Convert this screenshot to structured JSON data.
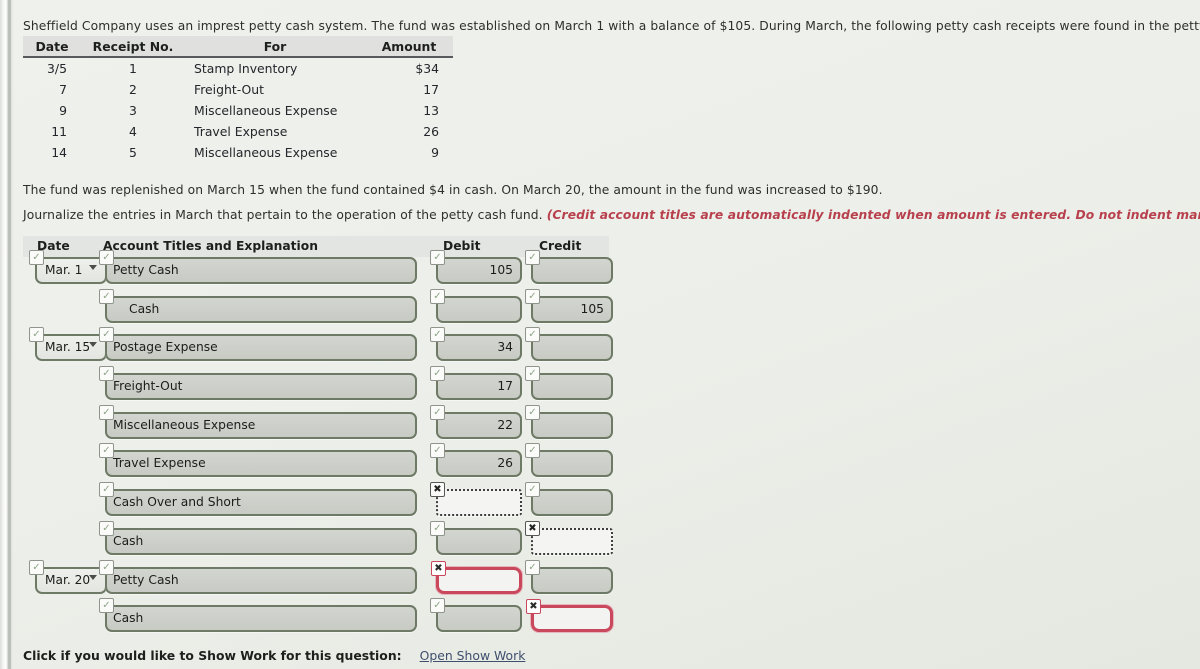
{
  "intro": {
    "text": "Sheffield Company uses an imprest petty cash system. The fund was established on March 1 with a balance of $105. During March, the following petty cash receipts were found in the petty cash box."
  },
  "receipts_table": {
    "columns": [
      "Date",
      "Receipt No.",
      "For",
      "Amount"
    ],
    "rows": [
      {
        "date": "3/5",
        "receipt_no": "1",
        "for": "Stamp Inventory",
        "amount": "$34"
      },
      {
        "date": "7",
        "receipt_no": "2",
        "for": "Freight-Out",
        "amount": "17"
      },
      {
        "date": "9",
        "receipt_no": "3",
        "for": "Miscellaneous Expense",
        "amount": "13"
      },
      {
        "date": "11",
        "receipt_no": "4",
        "for": "Travel Expense",
        "amount": "26"
      },
      {
        "date": "14",
        "receipt_no": "5",
        "for": "Miscellaneous Expense",
        "amount": "9"
      }
    ]
  },
  "statements": {
    "fund": "The fund was replenished on March 15 when the fund contained $4 in cash. On March 20, the amount in the fund was increased to $190.",
    "instruction_plain": "Journalize the entries in March that pertain to the operation of the petty cash fund. ",
    "instruction_emphasis": "(Credit account titles are automatically indented when amount is entered. Do not indent manually. Record journa"
  },
  "journal": {
    "columns": {
      "date": "Date",
      "account": "Account Titles and Explanation",
      "debit": "Debit",
      "credit": "Credit"
    },
    "rows": [
      {
        "date": "Mar. 1",
        "account": "Petty Cash",
        "indent": false,
        "debit": "105",
        "credit": "",
        "acct_status": "ok",
        "debit_status": "ok",
        "credit_status": "ok"
      },
      {
        "date": "",
        "account": "Cash",
        "indent": true,
        "debit": "",
        "credit": "105",
        "acct_status": "ok",
        "debit_status": "ok",
        "credit_status": "ok"
      },
      {
        "date": "Mar. 15",
        "account": "Postage Expense",
        "indent": false,
        "debit": "34",
        "credit": "",
        "acct_status": "ok",
        "debit_status": "ok",
        "credit_status": "ok"
      },
      {
        "date": "",
        "account": "Freight-Out",
        "indent": false,
        "debit": "17",
        "credit": "",
        "acct_status": "ok",
        "debit_status": "ok",
        "credit_status": "ok"
      },
      {
        "date": "",
        "account": "Miscellaneous Expense",
        "indent": false,
        "debit": "22",
        "credit": "",
        "acct_status": "ok",
        "debit_status": "ok",
        "credit_status": "ok"
      },
      {
        "date": "",
        "account": "Travel Expense",
        "indent": false,
        "debit": "26",
        "credit": "",
        "acct_status": "ok",
        "debit_status": "ok",
        "credit_status": "ok"
      },
      {
        "date": "",
        "account": "Cash Over and Short",
        "indent": false,
        "debit": "",
        "credit": "",
        "acct_status": "ok",
        "debit_status": "dotted",
        "credit_status": "ok"
      },
      {
        "date": "",
        "account": "Cash",
        "indent": false,
        "debit": "",
        "credit": "",
        "acct_status": "ok",
        "debit_status": "ok",
        "credit_status": "dotted"
      },
      {
        "date": "Mar. 20",
        "account": "Petty Cash",
        "indent": false,
        "debit": "",
        "credit": "",
        "acct_status": "ok",
        "debit_status": "red",
        "credit_status": "ok"
      },
      {
        "date": "",
        "account": "Cash",
        "indent": false,
        "debit": "",
        "credit": "",
        "acct_status": "ok",
        "debit_status": "ok",
        "credit_status": "red"
      }
    ],
    "status_glyphs": {
      "ok": "✓",
      "dotted": "✖",
      "red": "✖"
    },
    "caret_icon": "chevron-down-icon"
  },
  "footer": {
    "prompt": "Click if you would like to Show Work for this question:",
    "link": "Open Show Work"
  },
  "colors": {
    "field_border": "#6e7a66",
    "error_red": "#c9485c",
    "emphasis_red": "#b8404d",
    "link": "#3f4f6e",
    "page_bg": "#eceee9"
  }
}
